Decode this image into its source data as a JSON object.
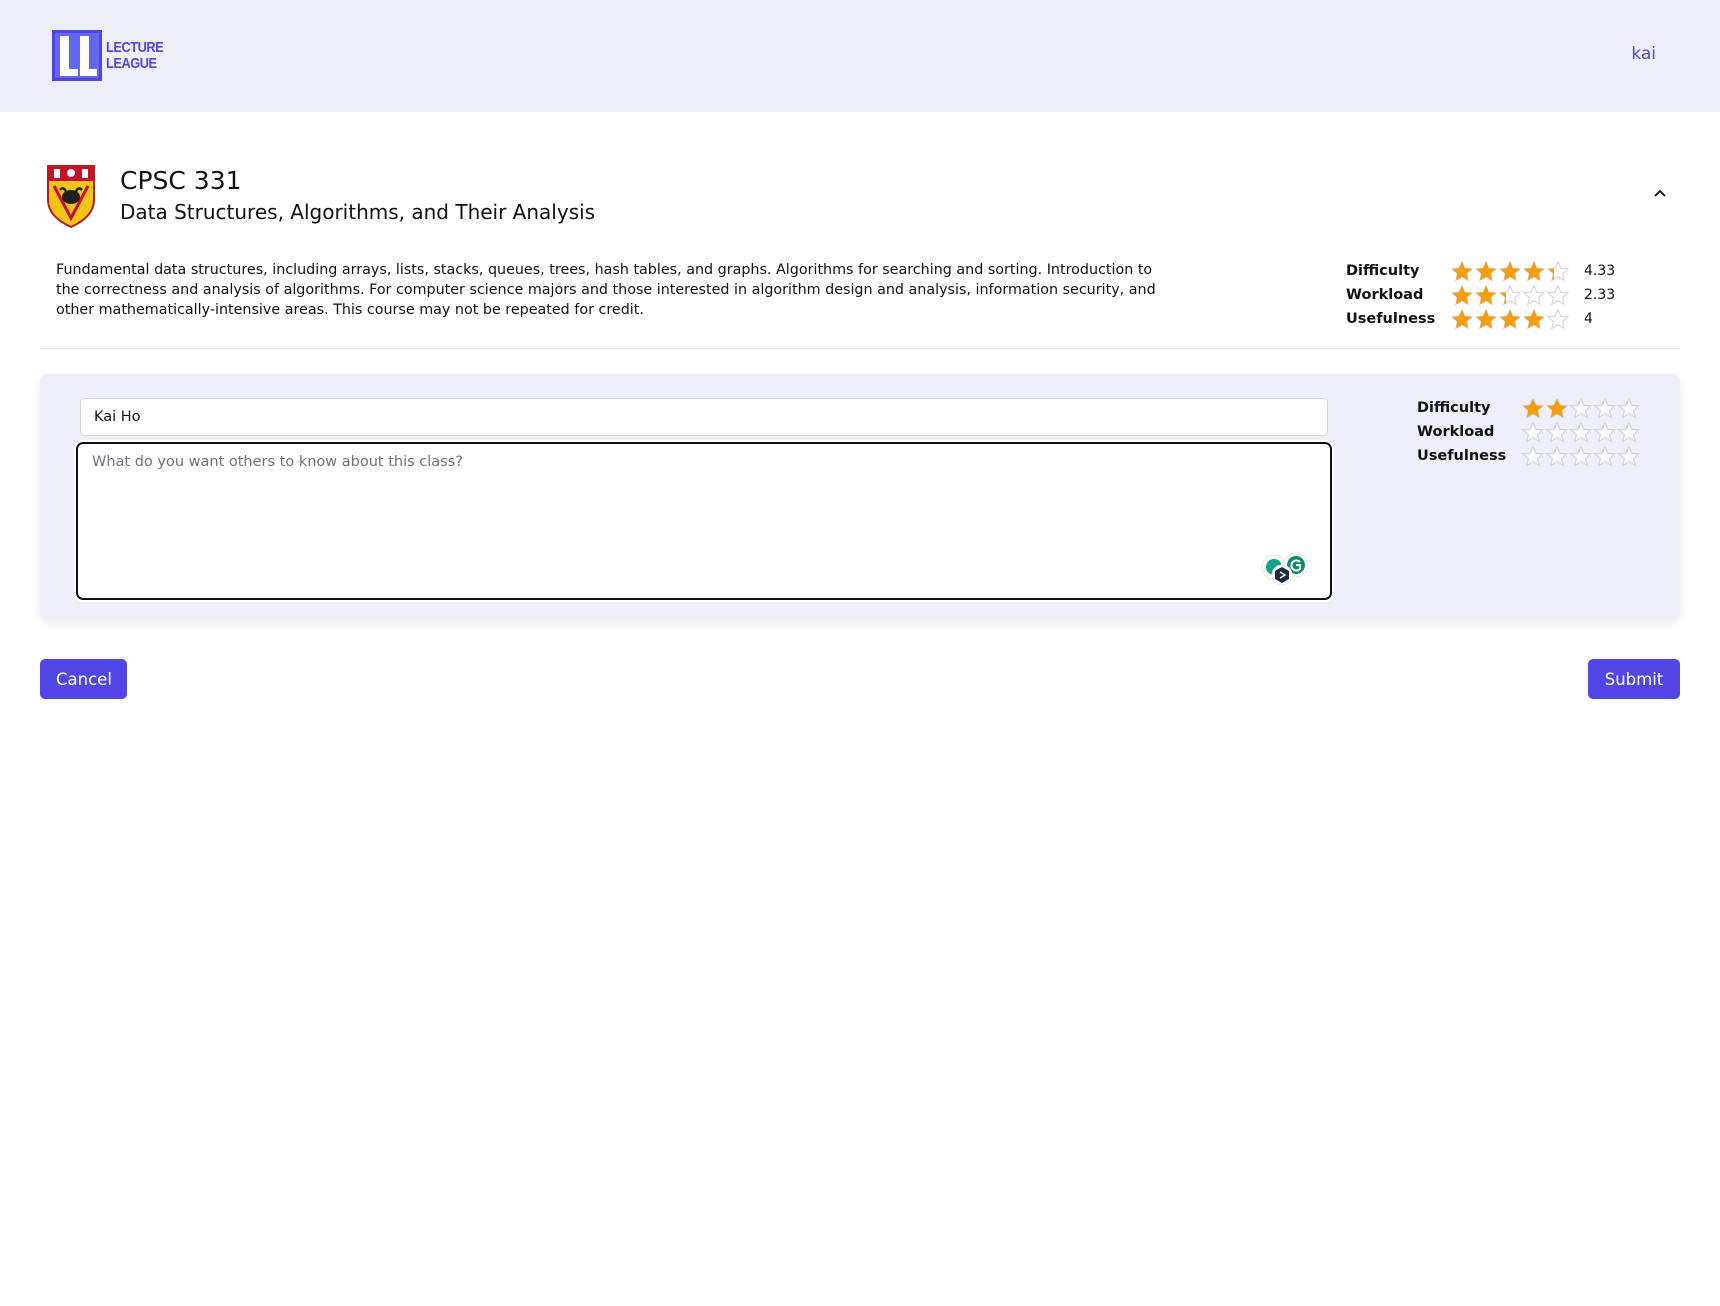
{
  "header": {
    "logo_line1": "LECTURE",
    "logo_line2": "LEAGUE",
    "user": "kai"
  },
  "course": {
    "code": "CPSC 331",
    "name": "Data Structures, Algorithms, and Their Analysis",
    "description": "Fundamental data structures, including arrays, lists, stacks, queues, trees, hash tables, and graphs. Algorithms for searching and sorting. Introduction to the correctness and analysis of algorithms. For computer science majors and those interested in algorithm design and analysis, information security, and other mathematically-intensive areas. This course may not be repeated for credit.",
    "ratings": [
      {
        "label": "Difficulty",
        "value": "4.33",
        "stars": 4.33
      },
      {
        "label": "Workload",
        "value": "2.33",
        "stars": 2.33
      },
      {
        "label": "Usefulness",
        "value": "4",
        "stars": 4
      }
    ]
  },
  "review_form": {
    "name_value": "Kai Ho",
    "text_placeholder": "What do you want others to know about this class?",
    "ratings": [
      {
        "label": "Difficulty",
        "stars": 2
      },
      {
        "label": "Workload",
        "stars": 0
      },
      {
        "label": "Usefulness",
        "stars": 0
      }
    ]
  },
  "actions": {
    "cancel_label": "Cancel",
    "submit_label": "Submit"
  },
  "colors": {
    "accent": "#4f46e5",
    "star_filled": "#f59e0b",
    "star_empty_stroke": "#d1d5db",
    "header_bg": "#eeeffb"
  }
}
